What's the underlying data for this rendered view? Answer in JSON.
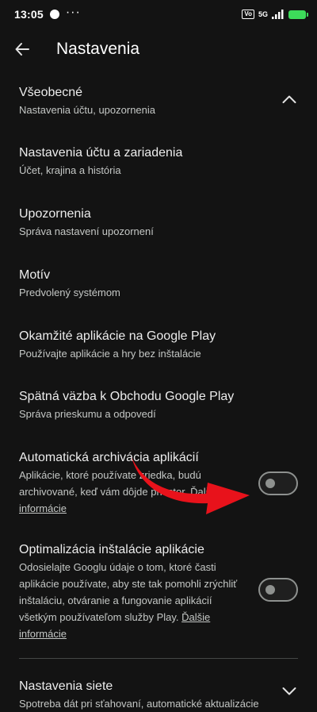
{
  "status_bar": {
    "time": "13:05",
    "more": "···",
    "vo_label": "Vo",
    "network_label": "5G"
  },
  "app_bar": {
    "back_icon": "arrow-back-icon",
    "title": "Nastavenia"
  },
  "sections": {
    "general": {
      "title": "Všeobecné",
      "subtitle": "Nastavenia účtu, upozornenia",
      "expanded": true
    },
    "network": {
      "title": "Nastavenia siete",
      "subtitle": "Spotreba dát pri sťahovaní, automatické aktualizácie",
      "expanded": false
    }
  },
  "items": [
    {
      "title": "Nastavenia účtu a zariadenia",
      "subtitle": "Účet, krajina a história"
    },
    {
      "title": "Upozornenia",
      "subtitle": "Správa nastavení upozornení"
    },
    {
      "title": "Motív",
      "subtitle": "Predvolený systémom"
    },
    {
      "title": "Okamžité aplikácie na Google Play",
      "subtitle": "Používajte aplikácie a hry bez inštalácie"
    },
    {
      "title": "Spätná väzba k Obchodu Google Play",
      "subtitle": "Správa prieskumu a odpovedí"
    }
  ],
  "toggles": {
    "auto_archive": {
      "title": "Automatická archivácia aplikácií",
      "description": "Aplikácie, ktoré používate zriedka, budú archivované, keď vám dôjde priestor.",
      "link": "Ďalšie informácie",
      "on": false
    },
    "install_optimization": {
      "title": "Optimalizácia inštalácie aplikácie",
      "description": "Odosielajte Googlu údaje o tom, ktoré časti aplikácie používate, aby ste tak pomohli zrýchliť inštaláciu, otváranie a fungovanie aplikácií všetkým používateľom služby Play.",
      "link": "Ďalšie informácie",
      "on": false
    }
  },
  "colors": {
    "background": "#131313",
    "annotation_arrow": "#e8121b",
    "toggle_outline": "#8e918f"
  }
}
